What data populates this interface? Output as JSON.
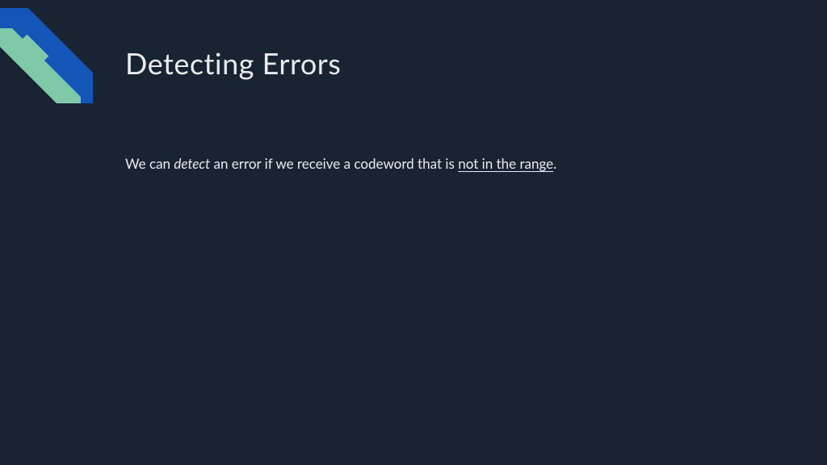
{
  "slide": {
    "title": "Detecting Errors",
    "body": {
      "prefix": "We can ",
      "detect": "detect",
      "middle": " an error if we receive a codeword that is ",
      "range": "not in the range",
      "suffix": "."
    }
  },
  "colors": {
    "background": "#1a2332",
    "accent_blue": "#1456b8",
    "accent_green": "#7fc9a8",
    "text": "#e8ebef"
  }
}
